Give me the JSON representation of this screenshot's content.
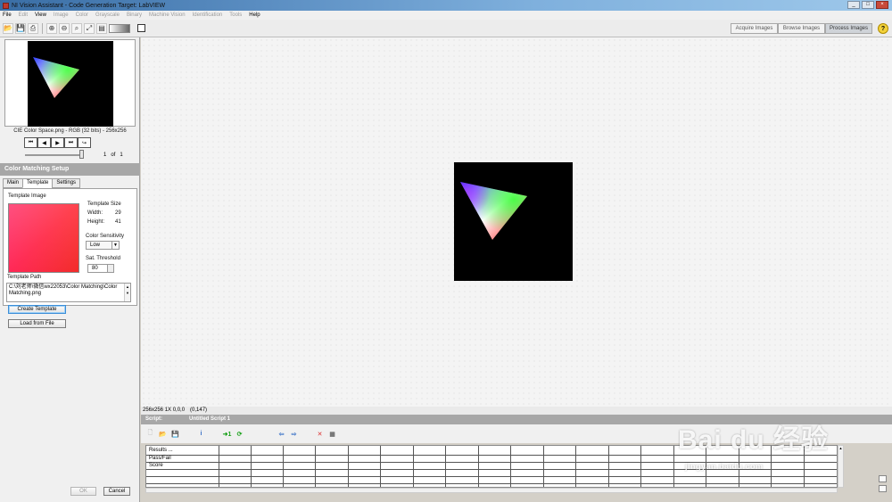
{
  "window": {
    "title": "NI Vision Assistant - Code Generation Target: LabVIEW"
  },
  "menu": [
    {
      "label": "File",
      "enabled": true
    },
    {
      "label": "Edit",
      "enabled": false
    },
    {
      "label": "View",
      "enabled": true
    },
    {
      "label": "Image",
      "enabled": false
    },
    {
      "label": "Color",
      "enabled": false
    },
    {
      "label": "Grayscale",
      "enabled": false
    },
    {
      "label": "Binary",
      "enabled": false
    },
    {
      "label": "Machine Vision",
      "enabled": false
    },
    {
      "label": "Identification",
      "enabled": false
    },
    {
      "label": "Tools",
      "enabled": false
    },
    {
      "label": "Help",
      "enabled": true
    }
  ],
  "mode_tabs": {
    "acquire": "Acquire Images",
    "browse": "Browse Images",
    "process": "Process Images",
    "active": "process"
  },
  "browser": {
    "caption": "CIE Color Space.png - RGB (32 bits) - 256x256",
    "page_current": "1",
    "page_of": "of",
    "page_total": "1"
  },
  "setup": {
    "header": "Color Matching Setup",
    "tabs": [
      "Main",
      "Template",
      "Settings"
    ],
    "active_tab": "Template",
    "template_image_label": "Template Image",
    "template_size_label": "Template Size",
    "width_label": "Width:",
    "width_value": "29",
    "height_label": "Height:",
    "height_value": "41",
    "color_sensitivity_label": "Color Sensitivity",
    "color_sensitivity_value": "Low",
    "sat_threshold_label": "Sat. Threshold",
    "sat_threshold_value": "80",
    "template_path_label": "Template Path",
    "template_path_value": "C:\\刘老师\\微信wx22053\\Color Matching\\Color Matching.png",
    "create_template": "Create Template",
    "load_from_file": "Load from File",
    "ok": "OK",
    "cancel": "Cancel"
  },
  "status": {
    "info": "256x256 1X 0,0,0",
    "coords": "(0,147)"
  },
  "script": {
    "label": "Script:",
    "name": "Untitled Script 1",
    "rows": [
      "Results ...",
      "Pass/Fail",
      "Score"
    ]
  },
  "watermark": {
    "main": "Bai du 经验",
    "sub": "jingyan.baidu.com"
  },
  "colors": {
    "header_gray": "#a7a7a7",
    "template_red": "#ee1d2a",
    "focus_blue": "#3b8ed8"
  }
}
